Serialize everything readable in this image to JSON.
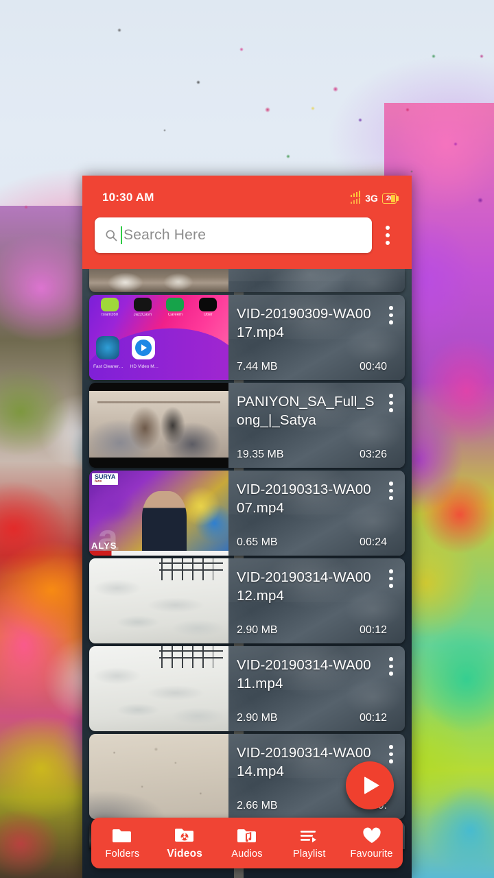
{
  "status_bar": {
    "time": "10:30 AM",
    "network": "3G",
    "battery_level": "26",
    "signal_icon": "signal-bars-icon",
    "battery_icon": "battery-icon"
  },
  "app_bar": {
    "background_color": "#f04434",
    "search": {
      "placeholder": "Search Here",
      "value": "",
      "icon": "search-icon"
    },
    "overflow_icon": "more-vert-icon"
  },
  "video_list": {
    "items": [
      {
        "title": "VID-20190309-WA0017.mp4",
        "size": "7.44 MB",
        "duration": "00:40",
        "thumb": "phone-home-screen",
        "menu_icon": "more-vert-icon"
      },
      {
        "title": "PANIYON_SA_Full_Song_|_Satya",
        "size": "19.35 MB",
        "duration": "03:26",
        "thumb": "couple-scene",
        "menu_icon": "more-vert-icon"
      },
      {
        "title": "VID-20190313-WA0007.mp4",
        "size": "0.65 MB",
        "duration": "00:24",
        "thumb": "news-anchor",
        "menu_icon": "more-vert-icon"
      },
      {
        "title": "VID-20190314-WA0012.mp4",
        "size": "2.90 MB",
        "duration": "00:12",
        "thumb": "snow-ground",
        "menu_icon": "more-vert-icon"
      },
      {
        "title": "VID-20190314-WA0011.mp4",
        "size": "2.90 MB",
        "duration": "00:12",
        "thumb": "snow-ground",
        "menu_icon": "more-vert-icon"
      },
      {
        "title": "VID-20190314-WA0014.mp4",
        "size": "2.66 MB",
        "duration": "00:",
        "thumb": "gravel-ground",
        "menu_icon": "more-vert-icon"
      }
    ]
  },
  "fab": {
    "icon": "play-icon",
    "color": "#f0402e"
  },
  "bottom_nav": {
    "background_color": "#f04434",
    "active": "Videos",
    "items": [
      {
        "label": "Folders",
        "icon": "folder-icon"
      },
      {
        "label": "Videos",
        "icon": "folder-video-icon"
      },
      {
        "label": "Audios",
        "icon": "folder-music-icon"
      },
      {
        "label": "Playlist",
        "icon": "playlist-icon"
      },
      {
        "label": "Favourite",
        "icon": "heart-icon"
      }
    ]
  }
}
